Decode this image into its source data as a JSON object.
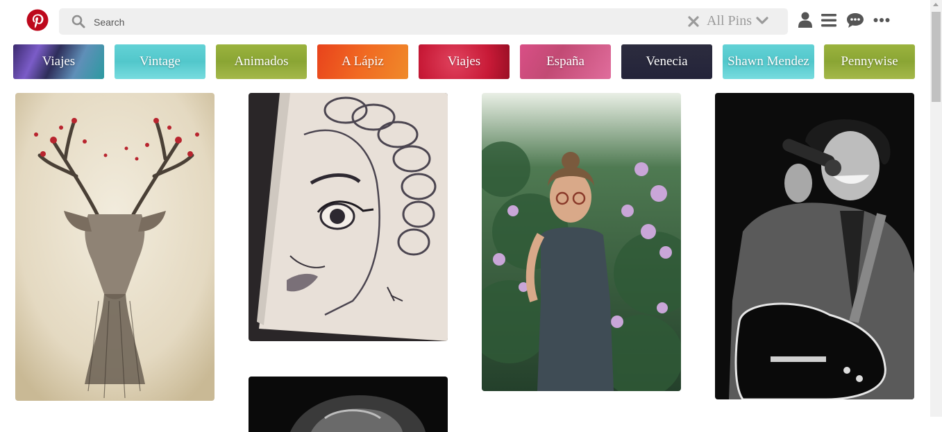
{
  "header": {
    "search_placeholder": "Search",
    "search_value": "",
    "filter_label": "All Pins",
    "icons": [
      "pinterest-logo",
      "search-icon",
      "close-icon",
      "chevron-down-icon",
      "user-icon",
      "menu-icon",
      "chat-icon",
      "more-icon"
    ]
  },
  "categories": [
    {
      "label": "Viajes",
      "bg": "linear-gradient(115deg,#3b2a6e 0%,#7b5cc8 25%,#2e2e5a 45%,#5f8fb8 70%,#2b9aa0 100%)"
    },
    {
      "label": "Vintage",
      "bg": "linear-gradient(180deg,#63d2d6 0%,#52c7cb 50%,#77dcdf 100%)"
    },
    {
      "label": "Animados",
      "bg": "linear-gradient(180deg,#9bb33e 0%,#8aa534 50%,#a5b84a 100%)"
    },
    {
      "label": "A Lápiz",
      "bg": "linear-gradient(110deg,#e8431c 0%,#f16a22 50%,#ef8a2a 100%)"
    },
    {
      "label": "Viajes",
      "bg": "radial-gradient(circle at 40% 50%,#e0435e 0%,#c81a37 60%,#9a0f25 100%)"
    },
    {
      "label": "España",
      "bg": "linear-gradient(120deg,#d94f86 0%,#c24a74 40%,#e06d9c 100%)"
    },
    {
      "label": "Venecia",
      "bg": "linear-gradient(180deg,#2c2c3e 0%,#24243a 100%)"
    },
    {
      "label": "Shawn Mendez",
      "bg": "linear-gradient(180deg,#63d2d6 0%,#52c7cb 50%,#77dcdf 100%)"
    },
    {
      "label": "Pennywise",
      "bg": "linear-gradient(180deg,#9bb33e 0%,#8aa534 50%,#a5b84a 100%)"
    }
  ],
  "pins": [
    {
      "name": "pin-deer-illustration",
      "label": ""
    },
    {
      "name": "pin-pencil-sketch-girl",
      "label": ""
    },
    {
      "name": "pin-girl-in-flowers-photo",
      "label": ""
    },
    {
      "name": "pin-guitarist-singer-photo",
      "label": ""
    },
    {
      "name": "pin-bw-portrait-photo",
      "label": ""
    }
  ],
  "colors": {
    "brand": "#bd081c",
    "icon": "#555555",
    "search_bg": "#efefef"
  }
}
